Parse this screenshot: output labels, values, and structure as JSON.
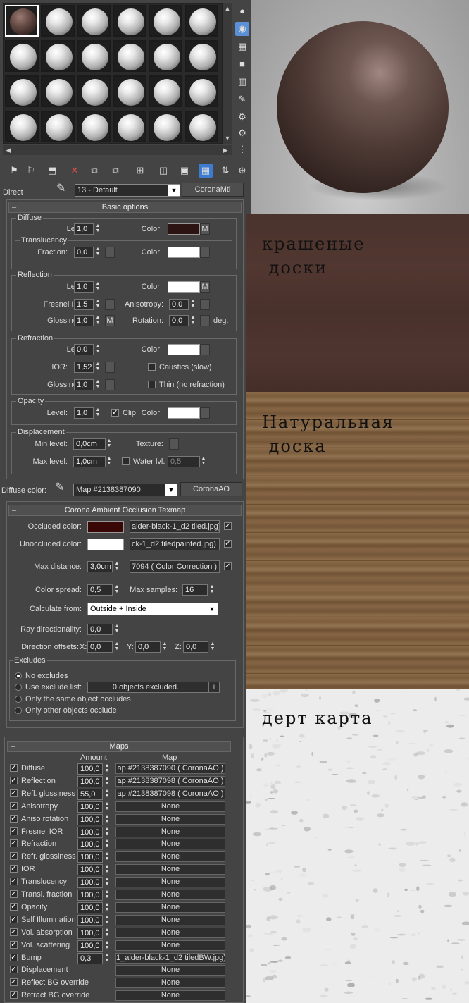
{
  "material_editor": {
    "toolbar_icons": [
      "get-material-icon",
      "put-to-scene-icon",
      "assign-to-selection-icon",
      "reset-map-icon",
      "copy-material-icon",
      "make-unique-icon",
      "put-to-library-icon",
      "material-id-channel-icon",
      "show-shaded-material-icon",
      "show-end-result-icon",
      "go-to-parent-icon",
      "go-forward-to-sibling-icon"
    ],
    "direct_label": "Direct",
    "material_name": "13 - Default",
    "material_type": "CoronaMtl",
    "basic_options_title": "Basic options",
    "diffuse": {
      "title": "Diffuse",
      "level_label": "Level:",
      "level": "1,0",
      "color_label": "Color:",
      "color": "#2b1411",
      "map_flag": "M",
      "translucency_title": "Translucency",
      "fraction_label": "Fraction:",
      "fraction": "0,0",
      "trans_color_label": "Color:",
      "trans_color": "#ffffff"
    },
    "reflection": {
      "title": "Reflection",
      "level_label": "Level:",
      "level": "1,0",
      "color_label": "Color:",
      "color": "#ffffff",
      "map_flag": "M",
      "fresnel_label": "Fresnel IOR:",
      "fresnel": "1,5",
      "anisotropy_label": "Anisotropy:",
      "anisotropy": "0,0",
      "glossiness_label": "Glossiness:",
      "glossiness": "1,0",
      "gloss_flag": "M",
      "rotation_label": "Rotation:",
      "rotation": "0,0",
      "deg": "deg."
    },
    "refraction": {
      "title": "Refraction",
      "level_label": "Level:",
      "level": "0,0",
      "color_label": "Color:",
      "color": "#ffffff",
      "ior_label": "IOR:",
      "ior": "1,52",
      "caustics_label": "Caustics (slow)",
      "glossiness_label": "Glossiness:",
      "glossiness": "1,0",
      "thin_label": "Thin (no refraction)"
    },
    "opacity": {
      "title": "Opacity",
      "level_label": "Level:",
      "level": "1,0",
      "clip_label": "Clip",
      "color_label": "Color:",
      "color": "#ffffff"
    },
    "displacement": {
      "title": "Displacement",
      "min_label": "Min level:",
      "min": "0,0cm",
      "texture_label": "Texture:",
      "max_label": "Max level:",
      "max": "1,0cm",
      "water_label": "Water lvl.",
      "water": "0,5"
    },
    "diffuse_color_label": "Diffuse color:",
    "diffuse_map_name": "Map #2138387090",
    "diffuse_map_type": "CoronaAO"
  },
  "ao": {
    "title": "Corona Ambient Occlusion Texmap",
    "occluded_label": "Occluded color:",
    "occluded_color": "#3a0707",
    "occluded_map": "alder-black-1_d2 tiled.jpg)",
    "unoccluded_label": "Unoccluded color:",
    "unoccluded_color": "#ffffff",
    "unoccluded_map": "ck-1_d2 tiledpainted.jpg)",
    "max_distance_label": "Max distance:",
    "max_distance": "3,0cm",
    "max_distance_map": "7094  ( Color Correction )",
    "color_spread_label": "Color spread:",
    "color_spread": "0,5",
    "max_samples_label": "Max samples:",
    "max_samples": "16",
    "calculate_label": "Calculate from:",
    "calculate": "Outside + Inside",
    "ray_dir_label": "Ray directionality:",
    "ray_dir": "0,0",
    "dir_offsets_label": "Direction offsets:",
    "x_label": "X:",
    "x": "0,0",
    "y_label": "Y:",
    "y": "0,0",
    "z_label": "Z:",
    "z": "0,0",
    "excludes_title": "Excludes",
    "no_excludes": "No excludes",
    "use_exclude": "Use exclude list:",
    "exclude_count": "0 objects excluded...",
    "plus": "+",
    "same_object": "Only the same object occludes",
    "other_objects": "Only other objects occlude"
  },
  "maps": {
    "title": "Maps",
    "amount_header": "Amount",
    "map_header": "Map",
    "rows": [
      {
        "name": "Diffuse",
        "amount": "100,0",
        "map": "ap #2138387090  ( CoronaAO )"
      },
      {
        "name": "Reflection",
        "amount": "100,0",
        "map": "ap #2138387098  ( CoronaAO )"
      },
      {
        "name": "Refl. glossiness",
        "amount": "55,0",
        "map": "ap #2138387098  ( CoronaAO )"
      },
      {
        "name": "Anisotropy",
        "amount": "100,0",
        "map": "None"
      },
      {
        "name": "Aniso rotation",
        "amount": "100,0",
        "map": "None"
      },
      {
        "name": "Fresnel IOR",
        "amount": "100,0",
        "map": "None"
      },
      {
        "name": "Refraction",
        "amount": "100,0",
        "map": "None"
      },
      {
        "name": "Refr. glossiness",
        "amount": "100,0",
        "map": "None"
      },
      {
        "name": "IOR",
        "amount": "100,0",
        "map": "None"
      },
      {
        "name": "Translucency",
        "amount": "100,0",
        "map": "None"
      },
      {
        "name": "Transl. fraction",
        "amount": "100,0",
        "map": "None"
      },
      {
        "name": "Opacity",
        "amount": "100,0",
        "map": "None"
      },
      {
        "name": "Self Illumination",
        "amount": "100,0",
        "map": "None"
      },
      {
        "name": "Vol. absorption",
        "amount": "100,0",
        "map": "None"
      },
      {
        "name": "Vol. scattering",
        "amount": "100,0",
        "map": "None"
      },
      {
        "name": "Bump",
        "amount": "0,3",
        "map": "1_alder-black-1_d2 tiledBW.jpg)"
      },
      {
        "name": "Displacement",
        "amount": "",
        "map": "None"
      },
      {
        "name": "Reflect BG override",
        "amount": "",
        "map": "None"
      },
      {
        "name": "Refract BG override",
        "amount": "",
        "map": "None"
      }
    ]
  },
  "previews": {
    "painted_label": "крашеные\n доски",
    "natural_label": "Натуральная\n доска",
    "dirt_label": "дерт карта"
  }
}
